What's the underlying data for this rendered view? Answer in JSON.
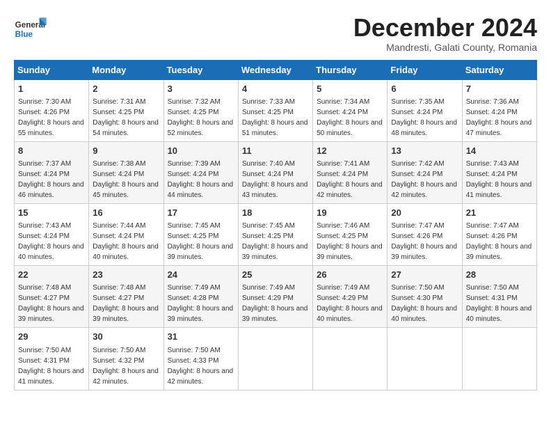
{
  "header": {
    "logo_general": "General",
    "logo_blue": "Blue",
    "month_title": "December 2024",
    "subtitle": "Mandresti, Galati County, Romania"
  },
  "weekdays": [
    "Sunday",
    "Monday",
    "Tuesday",
    "Wednesday",
    "Thursday",
    "Friday",
    "Saturday"
  ],
  "weeks": [
    [
      {
        "day": "1",
        "sunrise": "7:30 AM",
        "sunset": "4:26 PM",
        "daylight": "8 hours and 55 minutes."
      },
      {
        "day": "2",
        "sunrise": "7:31 AM",
        "sunset": "4:25 PM",
        "daylight": "8 hours and 54 minutes."
      },
      {
        "day": "3",
        "sunrise": "7:32 AM",
        "sunset": "4:25 PM",
        "daylight": "8 hours and 52 minutes."
      },
      {
        "day": "4",
        "sunrise": "7:33 AM",
        "sunset": "4:25 PM",
        "daylight": "8 hours and 51 minutes."
      },
      {
        "day": "5",
        "sunrise": "7:34 AM",
        "sunset": "4:24 PM",
        "daylight": "8 hours and 50 minutes."
      },
      {
        "day": "6",
        "sunrise": "7:35 AM",
        "sunset": "4:24 PM",
        "daylight": "8 hours and 48 minutes."
      },
      {
        "day": "7",
        "sunrise": "7:36 AM",
        "sunset": "4:24 PM",
        "daylight": "8 hours and 47 minutes."
      }
    ],
    [
      {
        "day": "8",
        "sunrise": "7:37 AM",
        "sunset": "4:24 PM",
        "daylight": "8 hours and 46 minutes."
      },
      {
        "day": "9",
        "sunrise": "7:38 AM",
        "sunset": "4:24 PM",
        "daylight": "8 hours and 45 minutes."
      },
      {
        "day": "10",
        "sunrise": "7:39 AM",
        "sunset": "4:24 PM",
        "daylight": "8 hours and 44 minutes."
      },
      {
        "day": "11",
        "sunrise": "7:40 AM",
        "sunset": "4:24 PM",
        "daylight": "8 hours and 43 minutes."
      },
      {
        "day": "12",
        "sunrise": "7:41 AM",
        "sunset": "4:24 PM",
        "daylight": "8 hours and 42 minutes."
      },
      {
        "day": "13",
        "sunrise": "7:42 AM",
        "sunset": "4:24 PM",
        "daylight": "8 hours and 42 minutes."
      },
      {
        "day": "14",
        "sunrise": "7:43 AM",
        "sunset": "4:24 PM",
        "daylight": "8 hours and 41 minutes."
      }
    ],
    [
      {
        "day": "15",
        "sunrise": "7:43 AM",
        "sunset": "4:24 PM",
        "daylight": "8 hours and 40 minutes."
      },
      {
        "day": "16",
        "sunrise": "7:44 AM",
        "sunset": "4:24 PM",
        "daylight": "8 hours and 40 minutes."
      },
      {
        "day": "17",
        "sunrise": "7:45 AM",
        "sunset": "4:25 PM",
        "daylight": "8 hours and 39 minutes."
      },
      {
        "day": "18",
        "sunrise": "7:45 AM",
        "sunset": "4:25 PM",
        "daylight": "8 hours and 39 minutes."
      },
      {
        "day": "19",
        "sunrise": "7:46 AM",
        "sunset": "4:25 PM",
        "daylight": "8 hours and 39 minutes."
      },
      {
        "day": "20",
        "sunrise": "7:47 AM",
        "sunset": "4:26 PM",
        "daylight": "8 hours and 39 minutes."
      },
      {
        "day": "21",
        "sunrise": "7:47 AM",
        "sunset": "4:26 PM",
        "daylight": "8 hours and 39 minutes."
      }
    ],
    [
      {
        "day": "22",
        "sunrise": "7:48 AM",
        "sunset": "4:27 PM",
        "daylight": "8 hours and 39 minutes."
      },
      {
        "day": "23",
        "sunrise": "7:48 AM",
        "sunset": "4:27 PM",
        "daylight": "8 hours and 39 minutes."
      },
      {
        "day": "24",
        "sunrise": "7:49 AM",
        "sunset": "4:28 PM",
        "daylight": "8 hours and 39 minutes."
      },
      {
        "day": "25",
        "sunrise": "7:49 AM",
        "sunset": "4:29 PM",
        "daylight": "8 hours and 39 minutes."
      },
      {
        "day": "26",
        "sunrise": "7:49 AM",
        "sunset": "4:29 PM",
        "daylight": "8 hours and 40 minutes."
      },
      {
        "day": "27",
        "sunrise": "7:50 AM",
        "sunset": "4:30 PM",
        "daylight": "8 hours and 40 minutes."
      },
      {
        "day": "28",
        "sunrise": "7:50 AM",
        "sunset": "4:31 PM",
        "daylight": "8 hours and 40 minutes."
      }
    ],
    [
      {
        "day": "29",
        "sunrise": "7:50 AM",
        "sunset": "4:31 PM",
        "daylight": "8 hours and 41 minutes."
      },
      {
        "day": "30",
        "sunrise": "7:50 AM",
        "sunset": "4:32 PM",
        "daylight": "8 hours and 42 minutes."
      },
      {
        "day": "31",
        "sunrise": "7:50 AM",
        "sunset": "4:33 PM",
        "daylight": "8 hours and 42 minutes."
      },
      null,
      null,
      null,
      null
    ]
  ]
}
